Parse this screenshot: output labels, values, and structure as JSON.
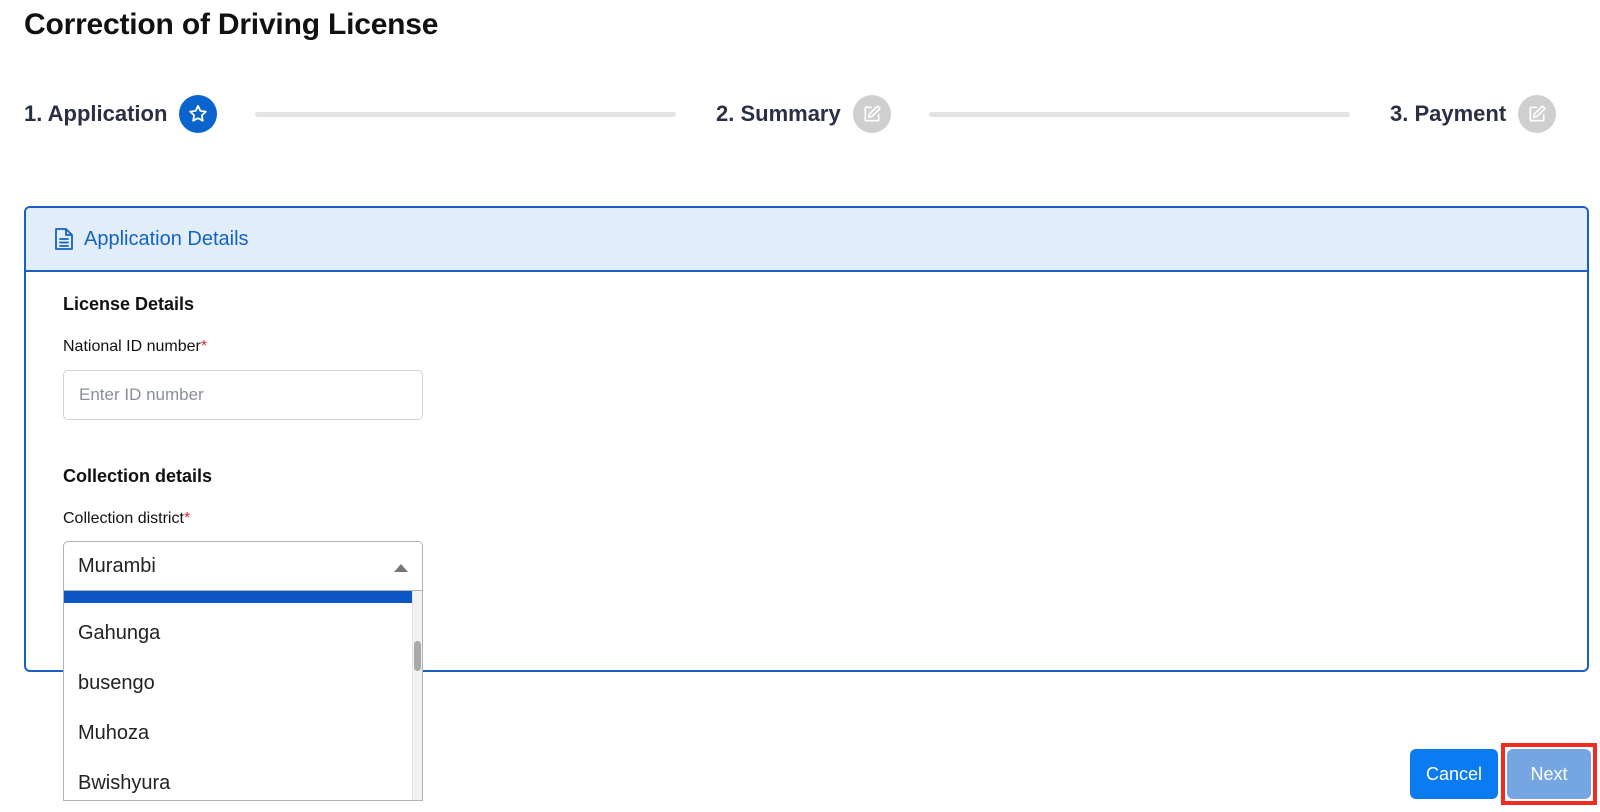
{
  "page": {
    "title": "Correction of Driving License"
  },
  "stepper": {
    "steps": [
      {
        "label": "1. Application",
        "icon": "star-icon",
        "state": "active"
      },
      {
        "label": "2. Summary",
        "icon": "edit-icon",
        "state": "inactive"
      },
      {
        "label": "3. Payment",
        "icon": "edit-icon",
        "state": "inactive"
      }
    ]
  },
  "card": {
    "title": "Application Details",
    "icon": "document-icon",
    "license_section": {
      "title": "License Details",
      "national_id_label": "National ID number",
      "required_mark": "*",
      "national_id_placeholder": "Enter ID number",
      "national_id_value": ""
    },
    "collection_section": {
      "title": "Collection details",
      "district_label": "Collection district",
      "required_mark": "*",
      "district_selected": "Murambi",
      "district_options_visible": [
        "Gahunga",
        "busengo",
        "Muhoza",
        "Bwishyura"
      ]
    }
  },
  "actions": {
    "cancel_label": "Cancel",
    "next_label": "Next"
  },
  "colors": {
    "primary": "#0b63ce",
    "step_inactive": "#cfcfcf",
    "card_border": "#1a5fc4",
    "card_header_bg": "#e1edf8",
    "required": "#e0253a",
    "cancel_bg": "#0a7bf0",
    "next_bg": "#76a6e2",
    "highlight_frame": "#f02b20"
  }
}
